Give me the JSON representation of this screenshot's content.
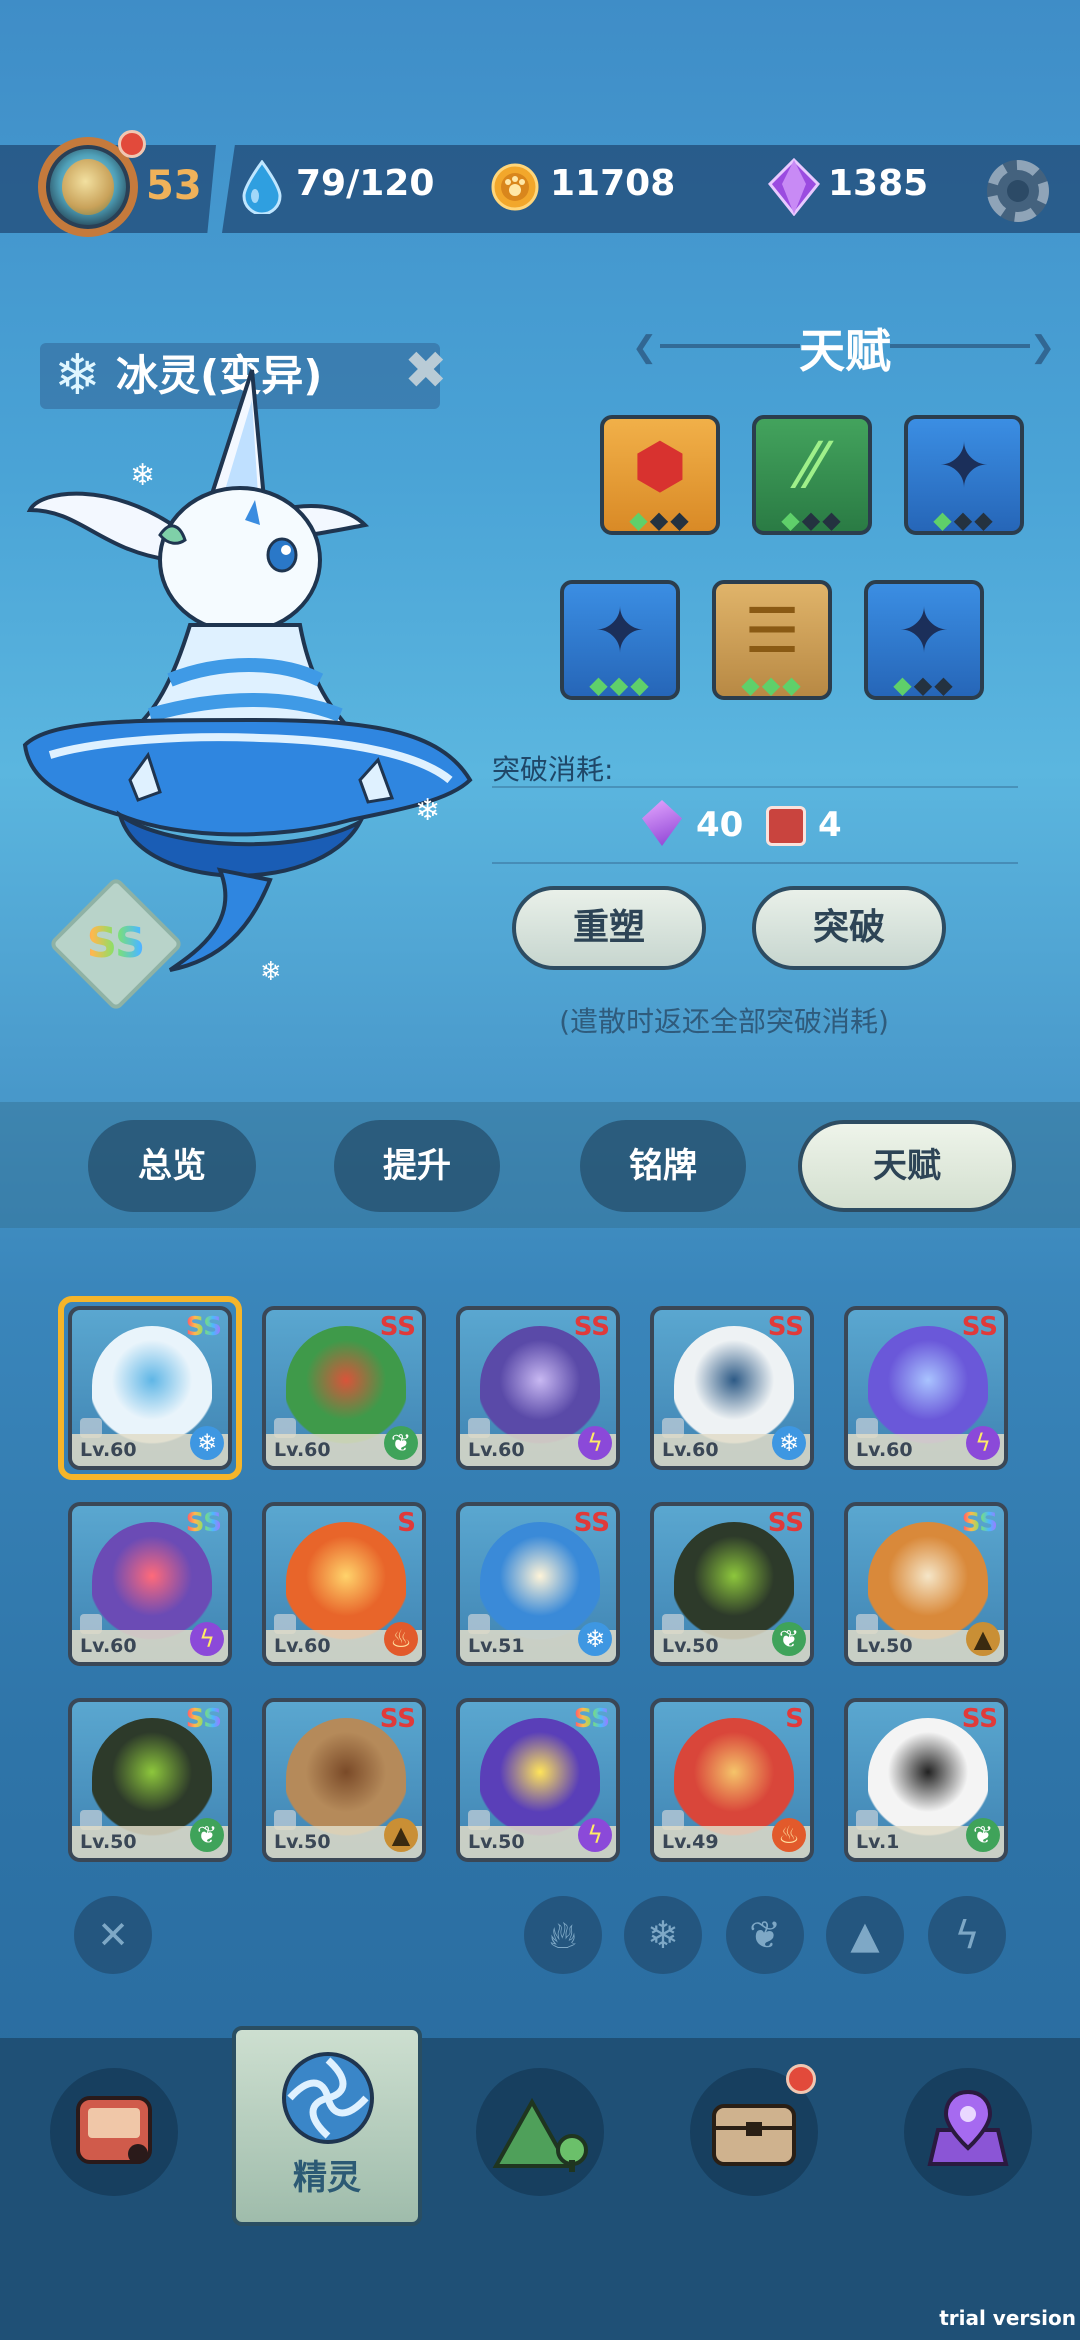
{
  "header": {
    "level": "53",
    "stamina": "79/120",
    "coins": "11708",
    "gems": "1385"
  },
  "spirit": {
    "name": "冰灵(变异)",
    "rank": "SS"
  },
  "talent": {
    "title": "天赋",
    "icons": [
      {
        "name": "ruby-hexagon-icon",
        "color": "orange",
        "filled": 1
      },
      {
        "name": "claw-slash-icon",
        "color": "green",
        "filled": 1
      },
      {
        "name": "ice-shard-icon",
        "color": "blue",
        "filled": 1
      },
      {
        "name": "sparkle-star-icon",
        "color": "blue",
        "filled": 3
      },
      {
        "name": "layered-bowls-icon",
        "color": "gold",
        "filled": 3
      },
      {
        "name": "sparkle-star-icon",
        "color": "blue",
        "filled": 1
      }
    ],
    "cost_label": "突破消耗:",
    "cost_gems": "40",
    "cost_books": "4",
    "reshape_label": "重塑",
    "breakthrough_label": "突破",
    "hint": "(遣散时返还全部突破消耗)"
  },
  "tabs": [
    "总览",
    "提升",
    "铭牌",
    "天赋"
  ],
  "active_tab": "天赋",
  "roster": [
    {
      "rank": "SS",
      "level": "Lv.60",
      "element": "ice",
      "body": "#e9f4fb",
      "accent": "#5fb6e6"
    },
    {
      "rank": "SS",
      "level": "Lv.60",
      "element": "grass",
      "body": "#3f9a4a",
      "accent": "#d9543a"
    },
    {
      "rank": "SS",
      "level": "Lv.60",
      "element": "electric",
      "body": "#5a4aa8",
      "accent": "#c8b8f2"
    },
    {
      "rank": "SS",
      "level": "Lv.60",
      "element": "ice",
      "body": "#eef2f4",
      "accent": "#2d5a86"
    },
    {
      "rank": "SS",
      "level": "Lv.60",
      "element": "electric",
      "body": "#6a58d9",
      "accent": "#a9c3ff"
    },
    {
      "rank": "SS",
      "level": "Lv.60",
      "element": "electric",
      "body": "#6b4bb5",
      "accent": "#ff6a7a"
    },
    {
      "rank": "S",
      "level": "Lv.60",
      "element": "fire",
      "body": "#e8652a",
      "accent": "#ffd36b"
    },
    {
      "rank": "SS",
      "level": "Lv.51",
      "element": "ice",
      "body": "#3a8ad8",
      "accent": "#fff4d8"
    },
    {
      "rank": "SS",
      "level": "Lv.50",
      "element": "grass",
      "body": "#2d3a2a",
      "accent": "#8dc73c"
    },
    {
      "rank": "SS",
      "level": "Lv.50",
      "element": "rock",
      "body": "#d9893a",
      "accent": "#f5e6c8"
    },
    {
      "rank": "SS",
      "level": "Lv.50",
      "element": "grass",
      "body": "#2d3a2a",
      "accent": "#8dc73c"
    },
    {
      "rank": "SS",
      "level": "Lv.50",
      "element": "rock",
      "body": "#b58a5a",
      "accent": "#7a4a28"
    },
    {
      "rank": "SS",
      "level": "Lv.50",
      "element": "electric",
      "body": "#5a3fb8",
      "accent": "#ffe45a"
    },
    {
      "rank": "S",
      "level": "Lv.49",
      "element": "fire",
      "body": "#d9463a",
      "accent": "#f5c46a"
    },
    {
      "rank": "SS",
      "level": "Lv.1",
      "element": "grass",
      "body": "#f4f4f4",
      "accent": "#222222"
    }
  ],
  "filters": [
    "clear-filter-icon",
    "fire-filter-icon",
    "ice-filter-icon",
    "grass-filter-icon",
    "rock-filter-icon",
    "electric-filter-icon"
  ],
  "nav": {
    "active_label": "精灵",
    "items": [
      "backpack-icon",
      "spirit-swirl-icon",
      "mountain-icon",
      "chest-icon",
      "map-pin-icon"
    ]
  },
  "watermark": "trial version"
}
